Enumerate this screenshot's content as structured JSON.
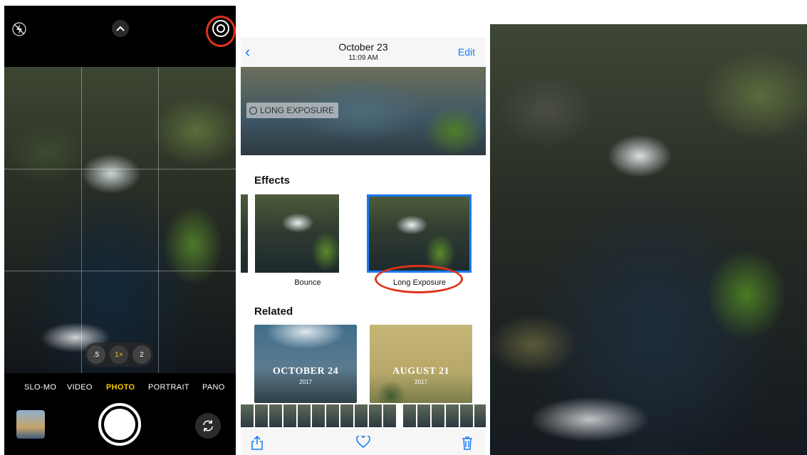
{
  "camera": {
    "modes": [
      "SLO-MO",
      "VIDEO",
      "PHOTO",
      "PORTRAIT",
      "PANO"
    ],
    "active_mode": "PHOTO",
    "zoom": [
      ".5",
      "1×",
      "2"
    ],
    "icons": {
      "flash": "flash-off-icon",
      "chevron": "chevron-up-icon",
      "live": "live-photo-icon",
      "flip": "camera-flip-icon"
    }
  },
  "photos": {
    "nav": {
      "back": "‹",
      "date": "October 23",
      "time": "11:09 AM",
      "edit": "Edit"
    },
    "badge": "LONG EXPOSURE",
    "effects_title": "Effects",
    "effects": [
      "Bounce",
      "Long Exposure"
    ],
    "related_title": "Related",
    "related": [
      {
        "title": "OCTOBER 24",
        "year": "2017"
      },
      {
        "title": "AUGUST 21",
        "year": "2017"
      }
    ],
    "toolbar_icons": [
      "share-icon",
      "heart-icon",
      "trash-icon"
    ]
  },
  "colors": {
    "accent": "#1a7cf5",
    "highlight": "#e0321b",
    "camera_yellow": "#f6c700"
  }
}
